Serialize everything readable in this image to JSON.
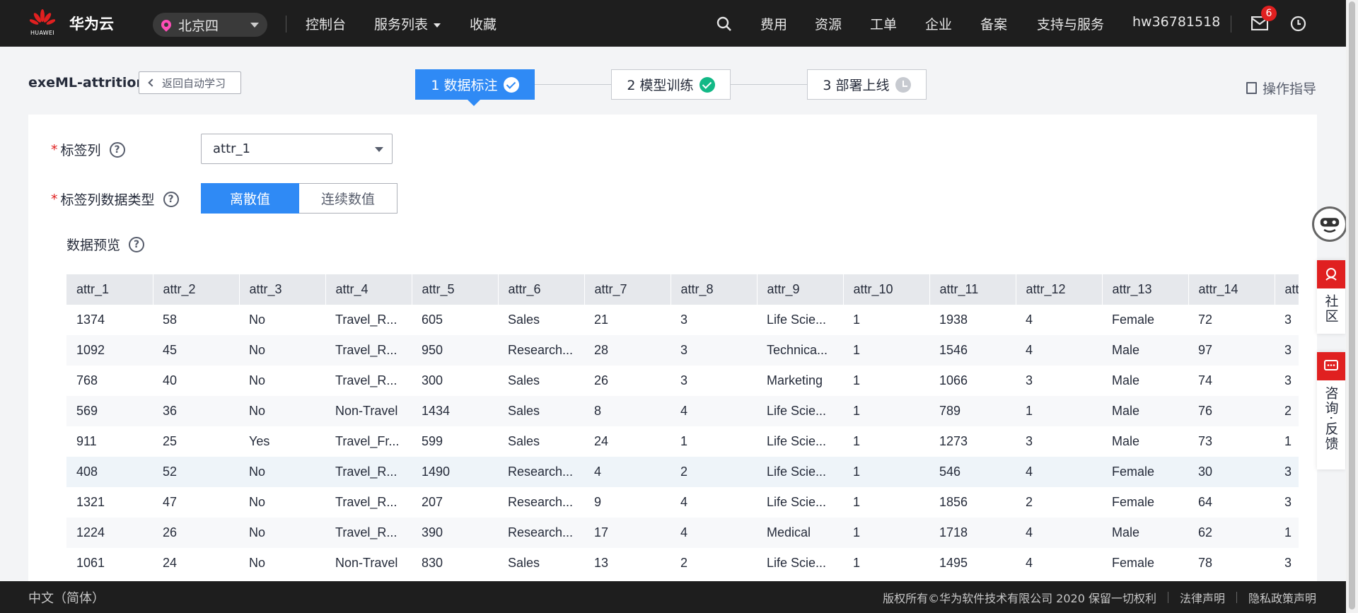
{
  "nav": {
    "logo_text": "HUAWEI",
    "brand": "华为云",
    "region": "北京四",
    "console": "控制台",
    "services": "服务列表",
    "favorites": "收藏",
    "links": [
      "费用",
      "资源",
      "工单",
      "企业",
      "备案",
      "支持与服务"
    ],
    "user": "hw36781518",
    "badge_count": "6"
  },
  "header": {
    "project": "exeML-attrition",
    "back": "返回自动学习",
    "steps": [
      "1 数据标注",
      "2 模型训练",
      "3 部署上线"
    ],
    "guide": "操作指导"
  },
  "form": {
    "label_column": "标签列",
    "label_value": "attr_1",
    "data_type_label": "标签列数据类型",
    "type_discrete": "离散值",
    "type_continuous": "连续数值",
    "preview": "数据预览"
  },
  "table": {
    "headers": [
      "attr_1",
      "attr_2",
      "attr_3",
      "attr_4",
      "attr_5",
      "attr_6",
      "attr_7",
      "attr_8",
      "attr_9",
      "attr_10",
      "attr_11",
      "attr_12",
      "attr_13",
      "attr_14",
      "attr_"
    ],
    "rows": [
      [
        "1374",
        "58",
        "No",
        "Travel_R...",
        "605",
        "Sales",
        "21",
        "3",
        "Life Scie...",
        "1",
        "1938",
        "4",
        "Female",
        "72",
        "3"
      ],
      [
        "1092",
        "45",
        "No",
        "Travel_R...",
        "950",
        "Research...",
        "28",
        "3",
        "Technica...",
        "1",
        "1546",
        "4",
        "Male",
        "97",
        "3"
      ],
      [
        "768",
        "40",
        "No",
        "Travel_R...",
        "300",
        "Sales",
        "26",
        "3",
        "Marketing",
        "1",
        "1066",
        "3",
        "Male",
        "74",
        "3"
      ],
      [
        "569",
        "36",
        "No",
        "Non-Travel",
        "1434",
        "Sales",
        "8",
        "4",
        "Life Scie...",
        "1",
        "789",
        "1",
        "Male",
        "76",
        "2"
      ],
      [
        "911",
        "25",
        "Yes",
        "Travel_Fr...",
        "599",
        "Sales",
        "24",
        "1",
        "Life Scie...",
        "1",
        "1273",
        "3",
        "Male",
        "73",
        "1"
      ],
      [
        "408",
        "52",
        "No",
        "Travel_R...",
        "1490",
        "Research...",
        "4",
        "2",
        "Life Scie...",
        "1",
        "546",
        "4",
        "Female",
        "30",
        "3"
      ],
      [
        "1321",
        "47",
        "No",
        "Travel_R...",
        "207",
        "Research...",
        "9",
        "4",
        "Life Scie...",
        "1",
        "1856",
        "2",
        "Female",
        "64",
        "3"
      ],
      [
        "1224",
        "26",
        "No",
        "Travel_R...",
        "390",
        "Research...",
        "17",
        "4",
        "Medical",
        "1",
        "1718",
        "4",
        "Male",
        "62",
        "1"
      ],
      [
        "1061",
        "24",
        "No",
        "Non-Travel",
        "830",
        "Sales",
        "13",
        "2",
        "Life Scie...",
        "1",
        "1495",
        "4",
        "Female",
        "78",
        "3"
      ]
    ]
  },
  "widgets": {
    "community": "社区",
    "consult": "咨询·反馈"
  },
  "footer": {
    "lang": "中文（简体）",
    "copyright": "版权所有©华为软件技术有限公司 2020 保留一切权利",
    "legal": "法律声明",
    "privacy": "隐私政策声明"
  },
  "colors": {
    "primary": "#2f8af5",
    "success": "#12b886",
    "nav_bg": "#1e1e1e",
    "alert": "#e02020"
  }
}
